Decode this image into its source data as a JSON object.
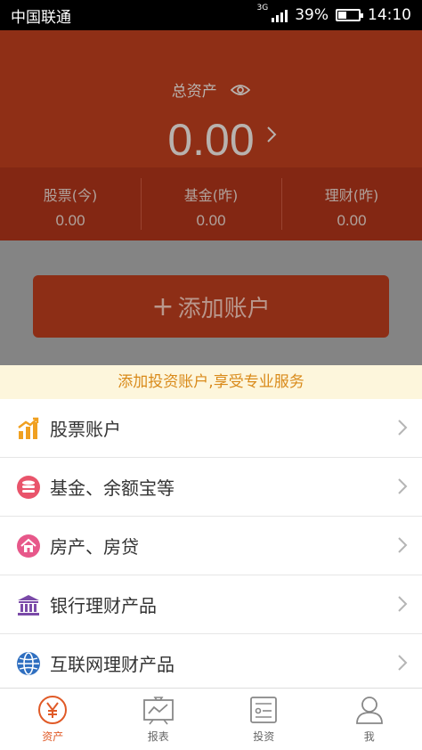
{
  "status_bar": {
    "carrier": "中国联通",
    "network": "3G",
    "battery": "39%",
    "time": "14:10"
  },
  "header": {
    "total_label": "总资产",
    "total_value": "0.00",
    "sub": [
      {
        "label": "股票(今)",
        "value": "0.00"
      },
      {
        "label": "基金(昨)",
        "value": "0.00"
      },
      {
        "label": "理财(昨)",
        "value": "0.00"
      }
    ]
  },
  "add_account": {
    "plus": "+",
    "label": "添加账户"
  },
  "promo": "添加投资账户,享受专业服务",
  "list": [
    {
      "label": "股票账户",
      "icon": "stock-chart-icon"
    },
    {
      "label": "基金、余额宝等",
      "icon": "coins-icon"
    },
    {
      "label": "房产、房贷",
      "icon": "house-icon"
    },
    {
      "label": "银行理财产品",
      "icon": "bank-icon"
    },
    {
      "label": "互联网理财产品",
      "icon": "globe-icon"
    }
  ],
  "nav": [
    {
      "label": "资产",
      "icon": "yen-icon",
      "active": true
    },
    {
      "label": "报表",
      "icon": "chart-board-icon"
    },
    {
      "label": "投资",
      "icon": "document-icon"
    },
    {
      "label": "我",
      "icon": "person-icon"
    }
  ],
  "colors": {
    "accent": "#e05a27",
    "header_bg": "#8f2f16",
    "promo_text": "#d98a1a"
  }
}
